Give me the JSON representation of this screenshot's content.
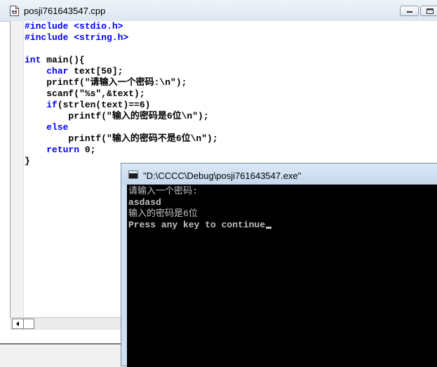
{
  "editor": {
    "title": "posji761643547.cpp",
    "code_lines": [
      [
        {
          "t": "#include <stdio.h>",
          "c": "kw"
        }
      ],
      [
        {
          "t": "#include <string.h>",
          "c": "kw"
        }
      ],
      [
        {
          "t": "",
          "c": ""
        }
      ],
      [
        {
          "t": "int",
          "c": "kw"
        },
        {
          "t": " main(){",
          "c": ""
        }
      ],
      [
        {
          "t": "    ",
          "c": ""
        },
        {
          "t": "char",
          "c": "kw"
        },
        {
          "t": " text[50];",
          "c": ""
        }
      ],
      [
        {
          "t": "    printf(\"请输入一个密码:\\n\");",
          "c": ""
        }
      ],
      [
        {
          "t": "    scanf(\"%s\",&text);",
          "c": ""
        }
      ],
      [
        {
          "t": "    ",
          "c": ""
        },
        {
          "t": "if",
          "c": "kw"
        },
        {
          "t": "(strlen(text)==6)",
          "c": ""
        }
      ],
      [
        {
          "t": "        printf(\"输入的密码是6位\\n\");",
          "c": ""
        }
      ],
      [
        {
          "t": "    ",
          "c": ""
        },
        {
          "t": "else",
          "c": "kw"
        }
      ],
      [
        {
          "t": "        printf(\"输入的密码不是6位\\n\");",
          "c": ""
        }
      ],
      [
        {
          "t": "    ",
          "c": ""
        },
        {
          "t": "return",
          "c": "kw"
        },
        {
          "t": " 0;",
          "c": ""
        }
      ],
      [
        {
          "t": "}",
          "c": ""
        }
      ]
    ]
  },
  "console": {
    "title": "\"D:\\CCCC\\Debug\\posji761643547.exe\"",
    "lines": [
      {
        "text": "请输入一个密码:",
        "bold": false
      },
      {
        "text": "asdasd",
        "bold": true
      },
      {
        "text": "输入的密码是6位",
        "bold": false
      },
      {
        "text": "Press any key to continue",
        "bold": true
      }
    ]
  },
  "colors": {
    "keyword": "#0000ff",
    "console_bg": "#000000",
    "console_text": "#c0c0c0"
  },
  "icons": {
    "editor_doc": "cpp-document-icon",
    "minimize": "minimize-icon",
    "maximize": "maximize-icon",
    "console_app": "console-app-icon",
    "scroll_left": "scroll-left-arrow-icon"
  }
}
